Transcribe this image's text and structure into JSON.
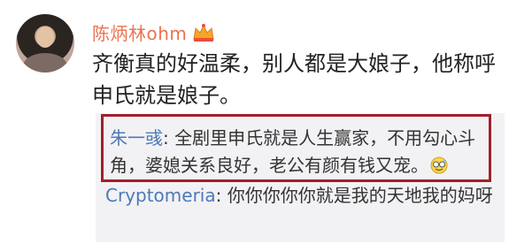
{
  "post": {
    "username": "陈炳林ohm",
    "text": "齐衡真的好温柔，别人都是大娘子，他称呼申氏就是娘子。"
  },
  "replies": [
    {
      "user": "朱一彧",
      "separator": ": ",
      "text": "全剧里申氏就是人生赢家，不用勾心斗角，婆媳关系良好，老公有颜有钱又宠。"
    },
    {
      "user": "Cryptomeria",
      "separator": ": ",
      "text": "你你你你你就是我的天地我的妈呀"
    }
  ],
  "colors": {
    "username": "#eb7350",
    "reply_user": "#4d7ab5",
    "highlight_border": "#a0212a",
    "reply_background": "#f2f2f5"
  },
  "icons": {
    "verified_badge": "crown-icon",
    "reply_emoji": "sweat-smile-emoji-icon"
  }
}
